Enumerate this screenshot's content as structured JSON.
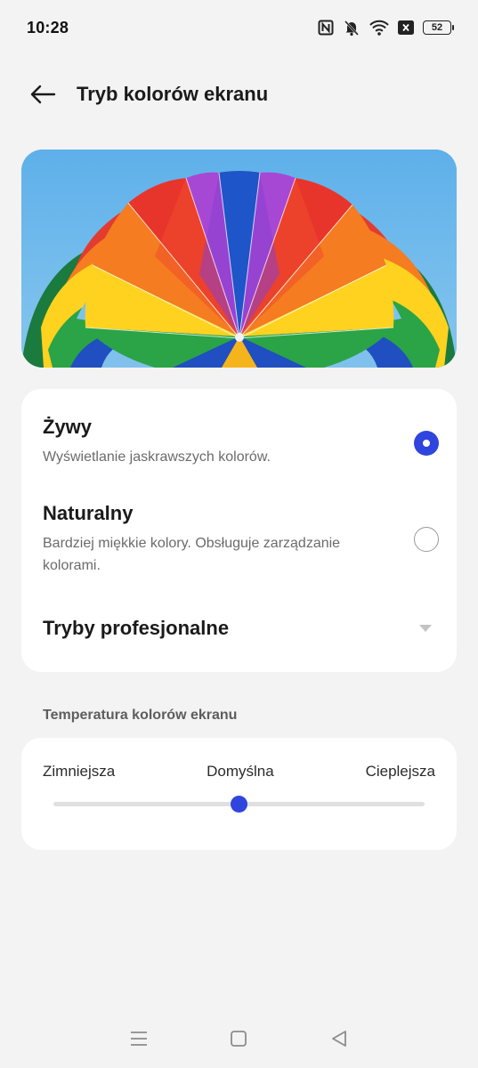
{
  "status_bar": {
    "time": "10:28",
    "battery": "52",
    "icons": [
      "nfc-icon",
      "bell-off-icon",
      "wifi-icon",
      "close-box-icon",
      "battery-icon"
    ]
  },
  "header": {
    "title": "Tryb kolorów ekranu",
    "back_icon": "arrow-left-icon"
  },
  "preview": {
    "image": "parachute-image"
  },
  "modes": [
    {
      "title": "Żywy",
      "description": "Wyświetlanie jaskrawszych kolorów.",
      "selected": true
    },
    {
      "title": "Naturalny",
      "description": "Bardziej miękkie kolory. Obsługuje zarządzanie kolorami.",
      "selected": false
    }
  ],
  "pro_modes": {
    "label": "Tryby profesjonalne",
    "icon": "chevron-down-icon"
  },
  "temperature": {
    "section_label": "Temperatura kolorów ekranu",
    "min_label": "Zimniejsza",
    "mid_label": "Domyślna",
    "max_label": "Cieplejsza",
    "value": 0.5
  },
  "colors": {
    "accent": "#2f45dd",
    "background": "#f3f3f3",
    "card": "#ffffff"
  },
  "nav_bar": [
    "menu-icon",
    "home-icon",
    "back-triangle-icon"
  ]
}
